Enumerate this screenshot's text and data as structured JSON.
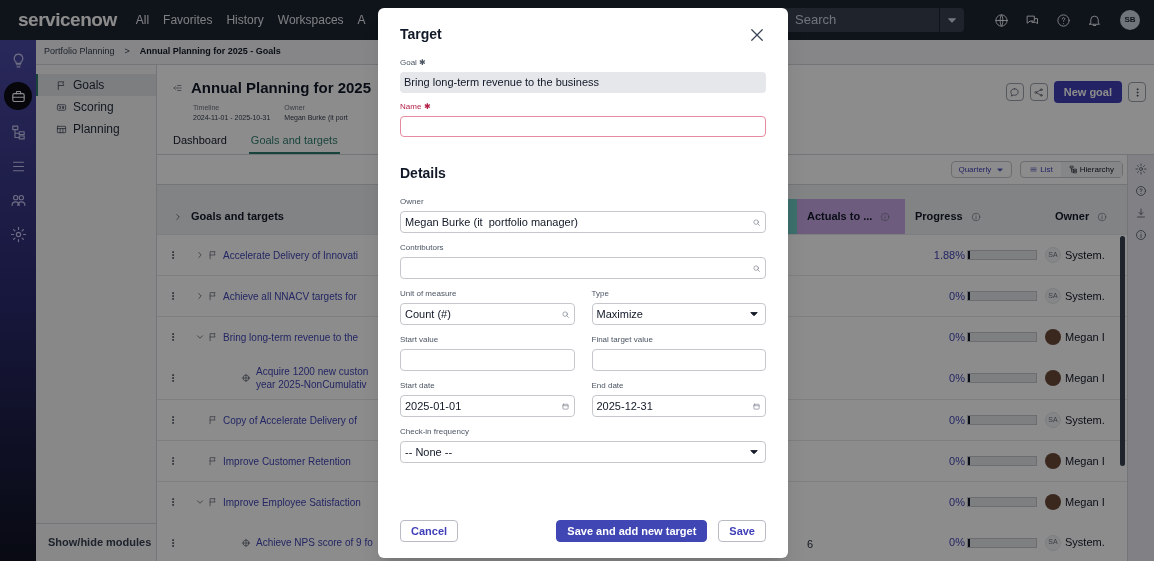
{
  "top_nav": {
    "logo": "servicenow",
    "items": [
      "All",
      "Favorites",
      "History",
      "Workspaces",
      "A"
    ],
    "search": {
      "placeholder": "Search"
    },
    "avatar": "SB"
  },
  "left_rail": [
    {
      "selected": false
    },
    {
      "selected": true
    },
    {
      "selected": false
    },
    {
      "selected": false
    },
    {
      "selected": false
    },
    {
      "selected": false
    }
  ],
  "breadcrumb": [
    "Portfolio Planning",
    ">",
    "Annual Planning for 2025 - Goals"
  ],
  "modules": {
    "items": [
      {
        "label": "Goals",
        "selected": true
      },
      {
        "label": "Scoring",
        "selected": false
      },
      {
        "label": "Planning",
        "selected": false
      }
    ],
    "footer": "Show/hide modules"
  },
  "header": {
    "title": "Annual Planning for 2025",
    "meta": [
      {
        "label": "Timeline",
        "value": "2024-11-01 - 2025-10-31"
      },
      {
        "label": "Owner",
        "value": "Megan Burke (it port"
      }
    ],
    "primary_button": "New goal"
  },
  "tabs": [
    {
      "label": "Dashboard",
      "selected": false
    },
    {
      "label": "Goals and targets",
      "selected": true
    }
  ],
  "toolbar": {
    "period": "Quarterly",
    "views": [
      {
        "label": "List",
        "selected": false
      },
      {
        "label": "Hierarchy",
        "selected": true
      }
    ]
  },
  "table": {
    "columns": [
      {
        "label": "Goals and targets",
        "kind": "tree"
      },
      {
        "kind": "sliver"
      },
      {
        "label": "Actuals to ...",
        "kind": "actuals"
      },
      {
        "label": "Progress",
        "kind": "progress"
      },
      {
        "label": "Owner",
        "kind": "owner"
      }
    ],
    "rows": [
      {
        "kind": "goal",
        "name": "Accelerate Delivery of Innovati",
        "has_children": true,
        "expanded": false,
        "progress": "1.88%",
        "level": 0.0188,
        "owner": {
          "kind": "initials",
          "initials": "SA",
          "name": "System."
        }
      },
      {
        "kind": "goal",
        "name": "Achieve all NNACV targets for",
        "has_children": true,
        "expanded": false,
        "progress": "0%",
        "level": 0,
        "owner": {
          "kind": "initials",
          "initials": "SA",
          "name": "System."
        }
      },
      {
        "kind": "goal",
        "name": "Bring long-term revenue to the",
        "has_children": true,
        "expanded": true,
        "progress": "0%",
        "level": 0,
        "owner": {
          "kind": "photo",
          "name": "Megan I"
        },
        "children": [
          {
            "kind": "target",
            "name": "Acquire 1200 new custon\nyear 2025-NonCumulativ",
            "has_children": false,
            "progress": "0%",
            "level": 0,
            "owner": {
              "kind": "photo",
              "name": "Megan I"
            }
          }
        ]
      },
      {
        "kind": "goal",
        "name": "Copy of Accelerate Delivery of",
        "has_children": false,
        "progress": "0%",
        "level": 0,
        "owner": {
          "kind": "initials",
          "initials": "SA",
          "name": "System."
        }
      },
      {
        "kind": "goal",
        "name": "Improve Customer Retention",
        "has_children": false,
        "progress": "0%",
        "level": 0,
        "owner": {
          "kind": "photo",
          "name": "Megan I"
        }
      },
      {
        "kind": "goal",
        "name": "Improve Employee Satisfaction",
        "has_children": true,
        "expanded": true,
        "progress": "0%",
        "level": 0,
        "owner": {
          "kind": "photo",
          "name": "Megan I"
        },
        "children": [
          {
            "kind": "target",
            "name": "Achieve NPS score of 9 fo",
            "has_children": false,
            "actuals": "6",
            "progress": "0%",
            "level": 0,
            "owner": {
              "kind": "initials",
              "initials": "SA",
              "name": "System."
            }
          }
        ]
      }
    ]
  },
  "dialog": {
    "title": "Target",
    "goal": {
      "label": "Goal ✱",
      "value": "Bring long-term revenue to the business"
    },
    "name": {
      "label": "Name ✱",
      "error": true
    },
    "section": "Details",
    "field_rows": [
      [
        {
          "label": "Owner",
          "kind": "lookup",
          "value": "Megan Burke (it  portfolio manager)"
        }
      ],
      [
        {
          "label": "Contributors",
          "kind": "lookup"
        }
      ],
      [
        {
          "label": "Unit of measure",
          "kind": "lookup",
          "value": "Count (#)"
        },
        {
          "label": "Type",
          "kind": "select",
          "value": "Maximize"
        }
      ],
      [
        {
          "label": "Start value",
          "kind": "text"
        },
        {
          "label": "Final target value",
          "kind": "text"
        }
      ],
      [
        {
          "label": "Start date",
          "kind": "date",
          "value": "2025-01-01"
        },
        {
          "label": "End date",
          "kind": "date",
          "value": "2025-12-31"
        }
      ],
      [
        {
          "label": "Check-in frequency",
          "kind": "select",
          "value": "-- None --"
        }
      ]
    ],
    "buttons": [
      {
        "label": "Cancel",
        "kind": "secondary"
      },
      {
        "label": "Save and add new target",
        "kind": "primary"
      },
      {
        "label": "Save",
        "kind": "secondary"
      }
    ]
  }
}
